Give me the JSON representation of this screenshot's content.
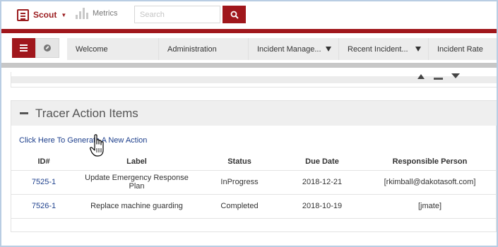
{
  "header": {
    "app_name": "Scout",
    "metrics_label": "Metrics",
    "search_placeholder": "Search"
  },
  "nav": {
    "tabs": [
      {
        "label": "Welcome",
        "has_dropdown": false
      },
      {
        "label": "Administration",
        "has_dropdown": false
      },
      {
        "label": "Incident Manage...",
        "has_dropdown": true
      },
      {
        "label": "Recent Incident...",
        "has_dropdown": true
      },
      {
        "label": "Incident Rate",
        "has_dropdown": false
      }
    ]
  },
  "tracer": {
    "title": "Tracer Action Items",
    "generate_link": "Click Here To Generate A New Action",
    "columns": [
      "ID#",
      "Label",
      "Status",
      "Due Date",
      "Responsible Person"
    ],
    "rows": [
      {
        "id": "7525-1",
        "label": "Update Emergency Response Plan",
        "status": "InProgress",
        "due_date": "2018-12-21",
        "person": "[rkimball@dakotasoft.com]"
      },
      {
        "id": "7526-1",
        "label": "Replace machine guarding",
        "status": "Completed",
        "due_date": "2018-10-19",
        "person": "[jmate]"
      }
    ]
  },
  "colors": {
    "brand_red": "#a0171c",
    "link_blue": "#1d3f8c",
    "frame_blue": "#b9cde3"
  }
}
